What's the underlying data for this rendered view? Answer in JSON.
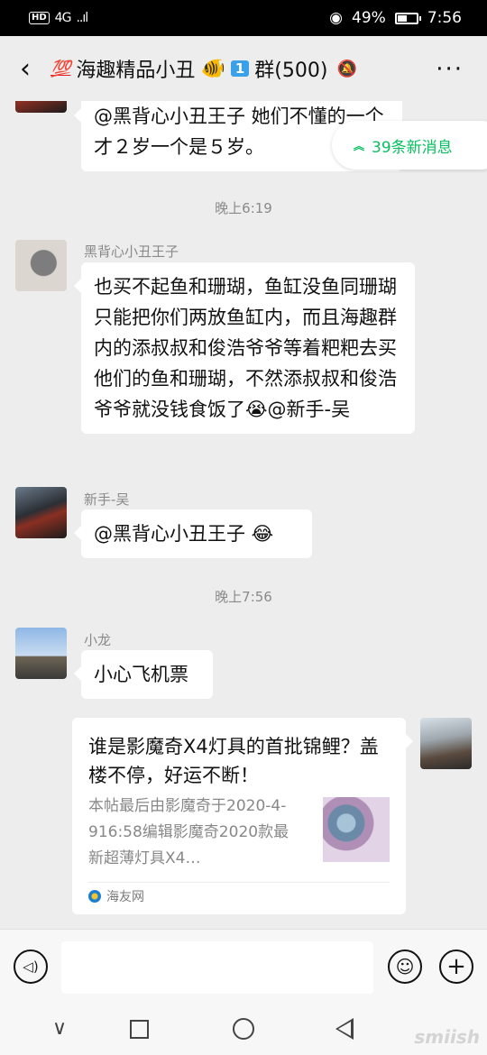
{
  "status_bar": {
    "hd": "HD",
    "network": "4G",
    "signal": "..ıl",
    "eye": "◉",
    "battery_percent": "49%",
    "battery_level": 0.49,
    "time": "7:56"
  },
  "header": {
    "back_icon": "‹",
    "badge": "💯",
    "title": "海趣精品小丑",
    "fish_icon": "🐠",
    "one": "1",
    "title_suffix": "群(500)",
    "mute_icon": "🔕",
    "more_icon": "···"
  },
  "new_messages": {
    "chevron": "︽",
    "label": "39条新消息"
  },
  "messages": [
    {
      "text": "@黑背心小丑王子  她们不懂的一个才２岁一个是５岁。"
    },
    {
      "time": "晚上6:19"
    },
    {
      "sender": "黑背心小丑王子",
      "text": "也买不起鱼和珊瑚，鱼缸没鱼同珊瑚只能把你们两放鱼缸内，而且海趣群内的添叔叔和俊浩爷爷等着粑粑去买他们的鱼和珊瑚，不然添叔叔和俊浩爷爷就没钱食饭了😭@新手-吴"
    },
    {
      "sender": "新手-吴",
      "text": "@黑背心小丑王子 😂"
    },
    {
      "time": "晚上7:56"
    },
    {
      "sender": "小龙",
      "text": "小心飞机票"
    }
  ],
  "card": {
    "title": "谁是影魔奇X4灯具的首批锦鲤？盖楼不停，好运不断！",
    "desc": "本帖最后由影魔奇于2020-4-916:58编辑影魔奇2020款最新超薄灯具X4…",
    "source": "海友网"
  },
  "input_bar": {
    "voice_icon": "◁)",
    "emoji_icon": "☺",
    "plus_icon": "+"
  },
  "nav_bar": {
    "down_icon": "∨",
    "watermark": "smiish"
  }
}
